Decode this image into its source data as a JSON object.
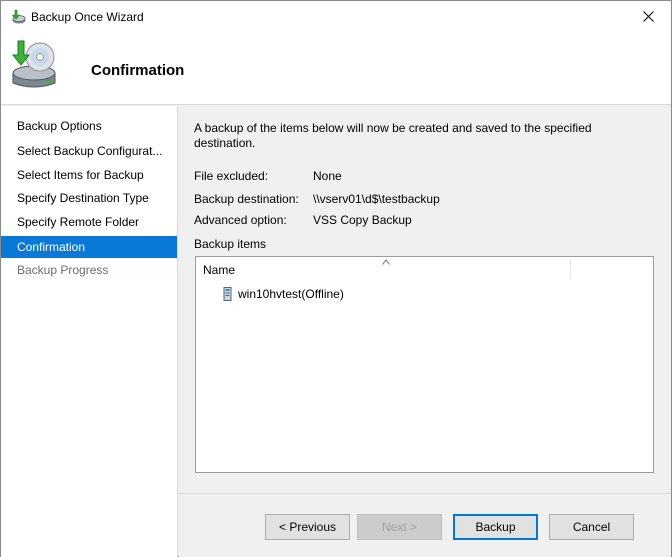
{
  "window": {
    "title": "Backup Once Wizard",
    "icons": {
      "app": "backup-wizard-icon",
      "close": "close-icon"
    }
  },
  "header": {
    "title": "Confirmation",
    "icon": "disk-backup-arrow-icon"
  },
  "sidebar": {
    "items": [
      {
        "label": "Backup Options",
        "state": "normal"
      },
      {
        "label": "Select Backup Configurat...",
        "state": "normal"
      },
      {
        "label": "Select Items for Backup",
        "state": "normal"
      },
      {
        "label": "Specify Destination Type",
        "state": "normal"
      },
      {
        "label": "Specify Remote Folder",
        "state": "normal"
      },
      {
        "label": "Confirmation",
        "state": "active"
      },
      {
        "label": "Backup Progress",
        "state": "disabled"
      }
    ]
  },
  "main": {
    "intro": "A backup of the items below will now be created and saved to the specified destination.",
    "details": [
      {
        "label": "File excluded:",
        "value": "None"
      },
      {
        "label": "Backup destination:",
        "value": "\\\\vserv01\\d$\\testbackup"
      },
      {
        "label": "Advanced option:",
        "value": "VSS Copy Backup"
      }
    ],
    "backup_items_label": "Backup items",
    "list": {
      "column_name": "Name",
      "sort": "ascending",
      "rows": [
        {
          "name": "win10hvtest(Offline)",
          "icon": "virtual-machine-icon"
        }
      ]
    }
  },
  "footer": {
    "previous_label": "< Previous",
    "next_label": "Next >",
    "backup_label": "Backup",
    "cancel_label": "Cancel"
  },
  "colors": {
    "accent": "#0a78d7",
    "window_bg": "#f0f0f0",
    "panel_bg": "#ffffff",
    "disabled_text": "#6d6d6d"
  }
}
